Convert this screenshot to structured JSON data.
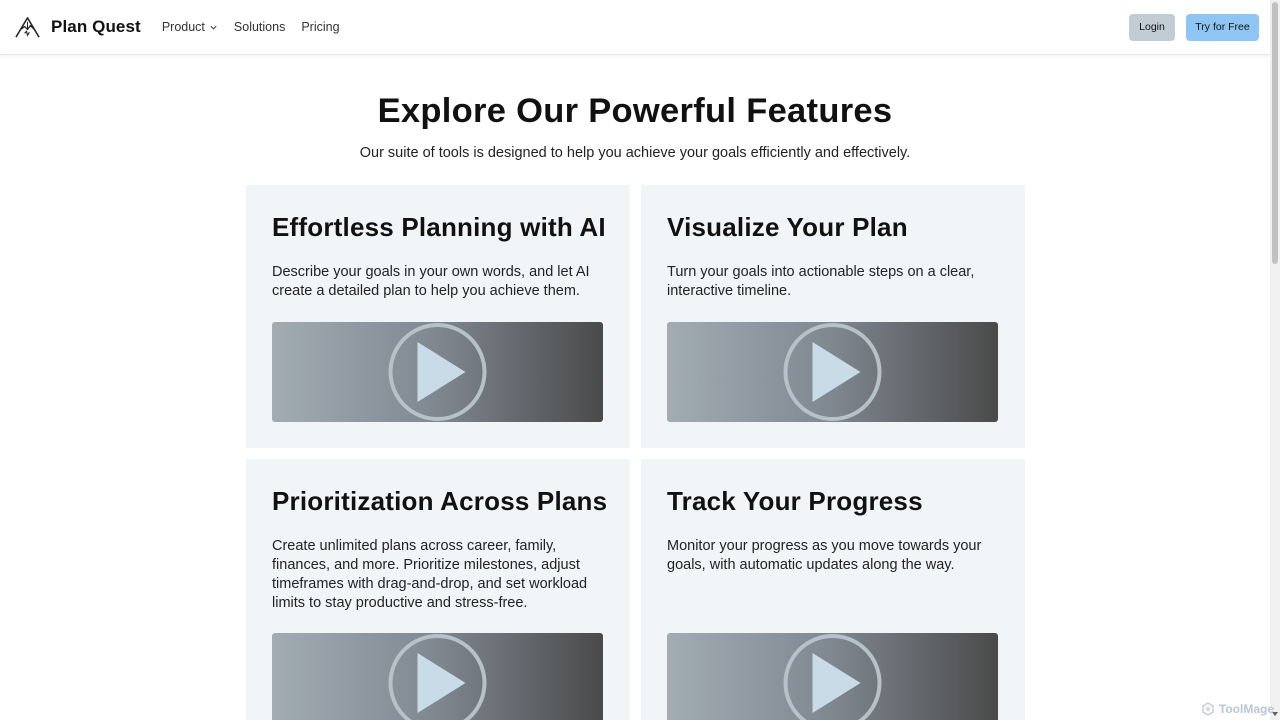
{
  "nav": {
    "brand": "Plan Quest",
    "links": [
      {
        "label": "Product"
      },
      {
        "label": "Solutions"
      },
      {
        "label": "Pricing"
      }
    ],
    "login_label": "Login",
    "try_label": "Try for Free"
  },
  "hero": {
    "title": "Explore Our Powerful Features",
    "subtitle": "Our suite of tools is designed to help you achieve your goals efficiently and effectively."
  },
  "features": [
    {
      "title": "Effortless Planning with AI",
      "description": "Describe your goals in your own words, and let AI create a detailed plan to help you achieve them."
    },
    {
      "title": "Visualize Your Plan",
      "description": "Turn your goals into actionable steps on a clear, interactive timeline."
    },
    {
      "title": "Prioritization Across Plans",
      "description": "Create unlimited plans across career, family, finances, and more. Prioritize milestones, adjust timeframes with drag-and-drop, and set workload limits to stay productive and stress-free."
    },
    {
      "title": "Track Your Progress",
      "description": "Monitor your progress as you move towards your goals, with automatic updates along the way."
    }
  ],
  "watermark": "ToolMage",
  "icons": {
    "logo": "mountain-logo-icon",
    "dropdown": "chevron-down-icon",
    "video": "play-icon"
  },
  "colors": {
    "try_button": "#8ec5f2",
    "login_button": "#c2ccd4",
    "card_background": "#f2f5f7"
  }
}
